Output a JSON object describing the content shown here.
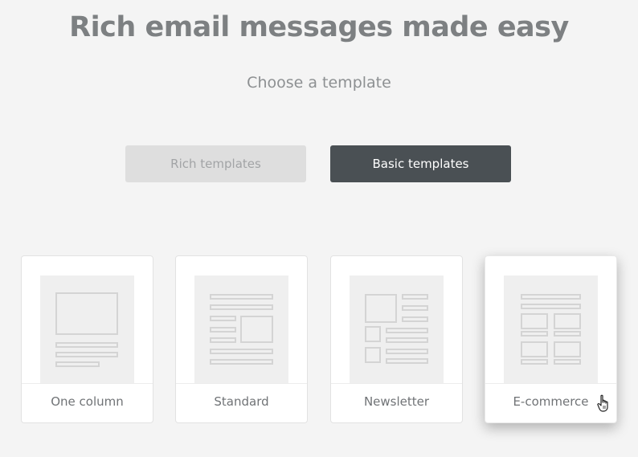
{
  "header": {
    "title": "Rich email messages made easy",
    "subtitle": "Choose a template"
  },
  "tabs": [
    {
      "label": "Rich templates",
      "active": false
    },
    {
      "label": "Basic templates",
      "active": true
    }
  ],
  "templates": [
    {
      "label": "One column",
      "icon": "one-column-layout-icon"
    },
    {
      "label": "Standard",
      "icon": "standard-layout-icon"
    },
    {
      "label": "Newsletter",
      "icon": "newsletter-layout-icon"
    },
    {
      "label": "E-commerce",
      "icon": "ecommerce-layout-icon",
      "hovered": true
    }
  ],
  "colors": {
    "background": "#f4f4f4",
    "title": "#7d8082",
    "active_tab": "#4a5054",
    "inactive_tab": "#dedede",
    "thumb_stroke": "#d4d4d4"
  }
}
